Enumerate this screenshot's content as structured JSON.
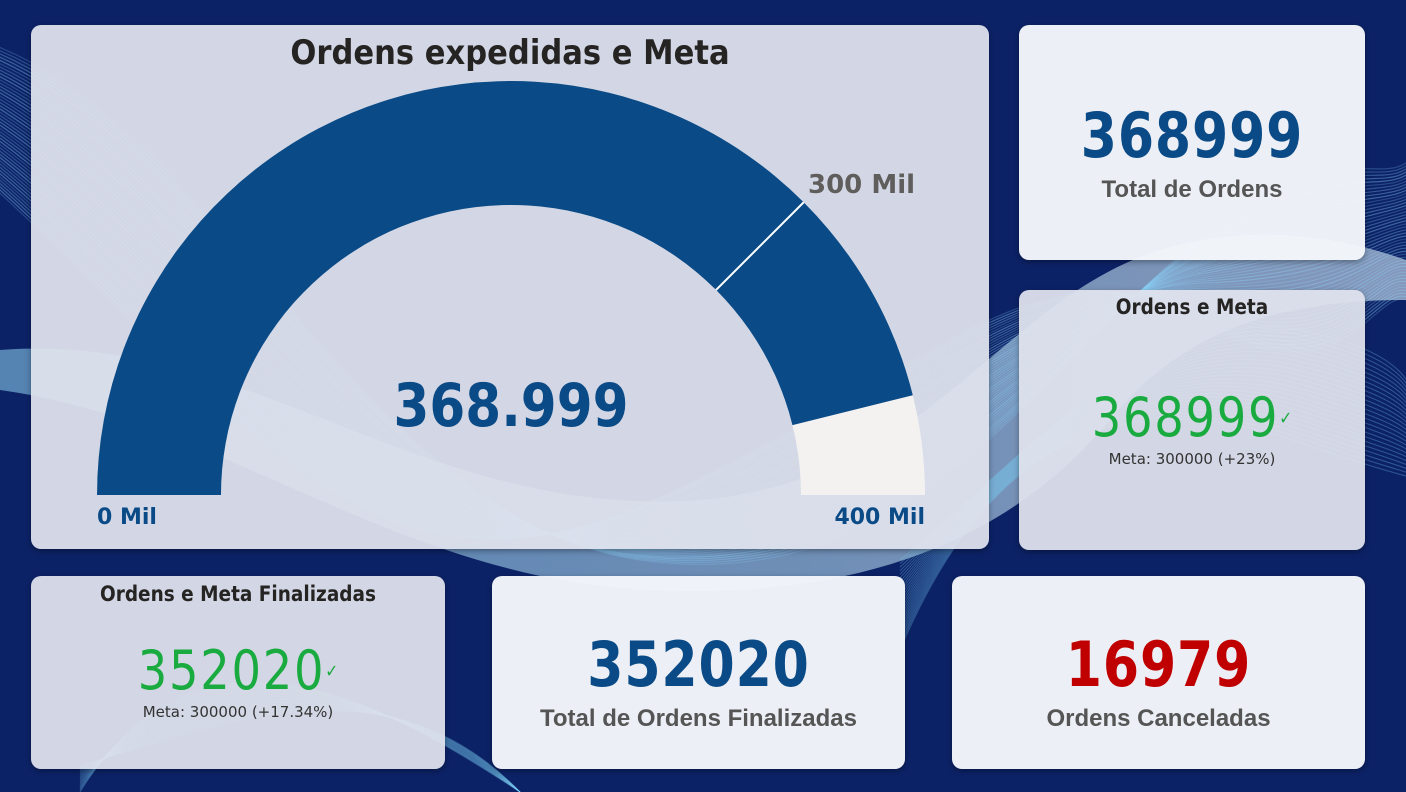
{
  "colors": {
    "page_bg": "#0c2266",
    "gauge_fill": "#0a4a86",
    "gauge_track": "#f3f2f1",
    "value_blue": "#0a4a86",
    "kpi_green": "#1aab40",
    "cancel_red": "#c00000"
  },
  "gauge": {
    "title": "Ordens expedidas e Meta",
    "value_label": "368.999",
    "min_label": "0 Mil",
    "max_label": "400 Mil",
    "target_label": "300 Mil",
    "value": 368999,
    "min": 0,
    "max": 400000,
    "target": 300000
  },
  "total_orders": {
    "value": "368999",
    "label": "Total de Ordens"
  },
  "orders_goal": {
    "title": "Ordens e Meta",
    "value": "368999",
    "check_icon": "✓",
    "goal_text": "Meta: 300000 (+23%)"
  },
  "finished_goal": {
    "title": "Ordens e Meta Finalizadas",
    "value": "352020",
    "check_icon": "✓",
    "goal_text": "Meta: 300000 (+17.34%)"
  },
  "finished_total": {
    "value": "352020",
    "label": "Total de Ordens Finalizadas"
  },
  "cancelled": {
    "value": "16979",
    "label": "Ordens Canceladas"
  }
}
